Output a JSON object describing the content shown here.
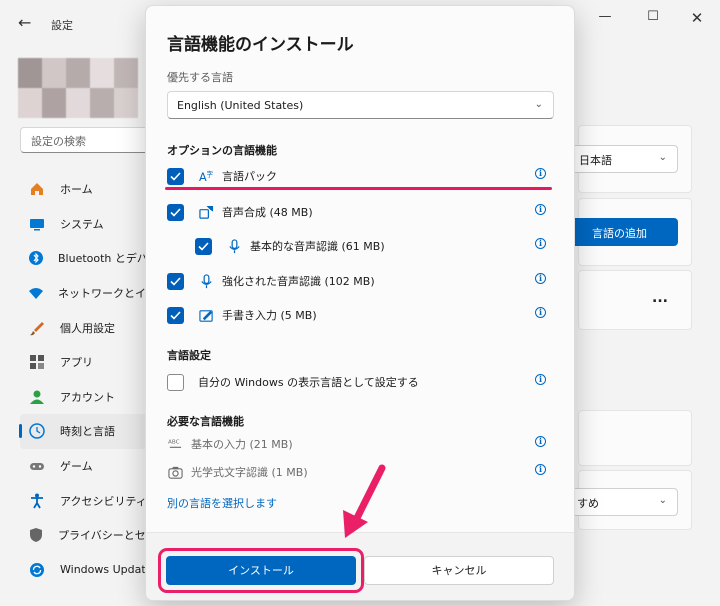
{
  "window": {
    "app_title": "設定",
    "back_label": "←",
    "minimize_label": "—",
    "maximize_label": "☐",
    "close_label": "✕"
  },
  "search": {
    "placeholder": "設定の検索"
  },
  "sidebar": {
    "items": [
      {
        "label": "ホーム",
        "icon": "home-icon",
        "color": "#e67e22"
      },
      {
        "label": "システム",
        "icon": "system-icon",
        "color": "#0078d4"
      },
      {
        "label": "Bluetooth とデバイ",
        "icon": "bluetooth-icon",
        "color": "#0078d4"
      },
      {
        "label": "ネットワークとインタ",
        "icon": "wifi-icon",
        "color": "#0078d4"
      },
      {
        "label": "個人用設定",
        "icon": "brush-icon",
        "color": "#d16b2a"
      },
      {
        "label": "アプリ",
        "icon": "apps-icon",
        "color": "#555555"
      },
      {
        "label": "アカウント",
        "icon": "account-icon",
        "color": "#2ea043"
      },
      {
        "label": "時刻と言語",
        "icon": "clock-globe-icon",
        "color": "#0078d4",
        "active": true
      },
      {
        "label": "ゲーム",
        "icon": "gamepad-icon",
        "color": "#777777"
      },
      {
        "label": "アクセシビリティ",
        "icon": "accessibility-icon",
        "color": "#0067c0"
      },
      {
        "label": "プライバシーとセキュ",
        "icon": "shield-icon",
        "color": "#666666"
      },
      {
        "label": "Windows Updat",
        "icon": "update-icon",
        "color": "#0078d4"
      }
    ]
  },
  "background": {
    "language_select": "日本語",
    "add_language_button": "言語の追加",
    "more_label": "...",
    "keyboard_select": "すめ"
  },
  "dialog": {
    "title": "言語機能のインストール",
    "preferred_label": "優先する言語",
    "preferred_value": "English (United States)",
    "optional_section": "オプションの言語機能",
    "optional_features": [
      {
        "label": "言語パック",
        "checked": true,
        "icon": "language-pack-icon"
      },
      {
        "label": "音声合成 (48 MB)",
        "checked": true,
        "icon": "speech-synthesis-icon"
      },
      {
        "label": "基本的な音声認識 (61 MB)",
        "checked": true,
        "icon": "microphone-icon"
      },
      {
        "label": "強化された音声認識 (102 MB)",
        "checked": true,
        "icon": "microphone-icon"
      },
      {
        "label": "手書き入力 (5 MB)",
        "checked": true,
        "icon": "handwriting-icon"
      }
    ],
    "settings_section": "言語設定",
    "display_language_option": "自分の Windows の表示言語として設定する",
    "required_section": "必要な言語機能",
    "required_features": [
      {
        "label": "基本の入力 (21 MB)",
        "icon": "abc-icon"
      },
      {
        "label": "光学式文字認識 (1 MB)",
        "icon": "camera-icon"
      }
    ],
    "choose_other_link": "別の言語を選択します",
    "install_button": "インストール",
    "cancel_button": "キャンセル"
  },
  "colors": {
    "accent": "#0067c0",
    "annotation": "#e8195f"
  }
}
